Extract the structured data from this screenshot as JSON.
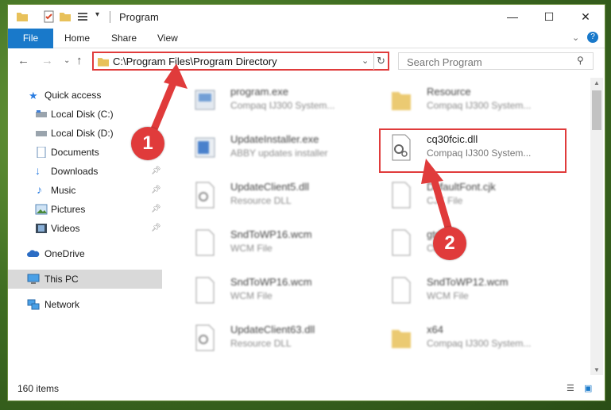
{
  "window": {
    "title": "Program"
  },
  "ribbon": {
    "tabs": [
      "File",
      "Home",
      "Share",
      "View"
    ]
  },
  "address": {
    "path": "C:\\Program Files\\Program Directory"
  },
  "search": {
    "placeholder": "Search Program"
  },
  "nav": {
    "items": [
      {
        "label": "Quick access",
        "icon": "star-icon"
      },
      {
        "label": "Local Disk (C:)",
        "icon": "drive-icon"
      },
      {
        "label": "Local Disk (D:)",
        "icon": "drive-icon"
      },
      {
        "label": "Documents",
        "icon": "documents-icon"
      },
      {
        "label": "Downloads",
        "icon": "download-icon",
        "pinned": true
      },
      {
        "label": "Music",
        "icon": "music-icon",
        "pinned": true
      },
      {
        "label": "Pictures",
        "icon": "pictures-icon",
        "pinned": true
      },
      {
        "label": "Videos",
        "icon": "videos-icon",
        "pinned": true
      },
      {
        "label": "OneDrive",
        "icon": "cloud-icon"
      },
      {
        "label": "This PC",
        "icon": "computer-icon",
        "selected": true
      },
      {
        "label": "Network",
        "icon": "network-icon"
      }
    ]
  },
  "files": [
    {
      "name": "program.exe",
      "desc": "Compaq IJ300 System..."
    },
    {
      "name": "Resource",
      "desc": "Compaq IJ300 System..."
    },
    {
      "name": "UpdateInstaller.exe",
      "desc": "ABBY updates installer"
    },
    {
      "name": "cq30fcic.dll",
      "desc": "Compaq IJ300 System..."
    },
    {
      "name": "UpdateClient5.dll",
      "desc": "Resource DLL"
    },
    {
      "name": "DefaultFont.cjk",
      "desc": "CJK File"
    },
    {
      "name": "SndToWP16.wcm",
      "desc": "WCM File"
    },
    {
      "name": "gtd...",
      "desc": "CKI..."
    },
    {
      "name": "SndToWP16.wcm",
      "desc": "WCM File"
    },
    {
      "name": "SndToWP12.wcm",
      "desc": "WCM File"
    },
    {
      "name": "UpdateClient63.dll",
      "desc": "Resource DLL"
    },
    {
      "name": "x64",
      "desc": "Compaq IJ300 System..."
    }
  ],
  "status": {
    "count": "160 items"
  },
  "callouts": [
    "1",
    "2"
  ],
  "colors": {
    "accent": "#1979ca",
    "highlight": "#e03b3b"
  }
}
